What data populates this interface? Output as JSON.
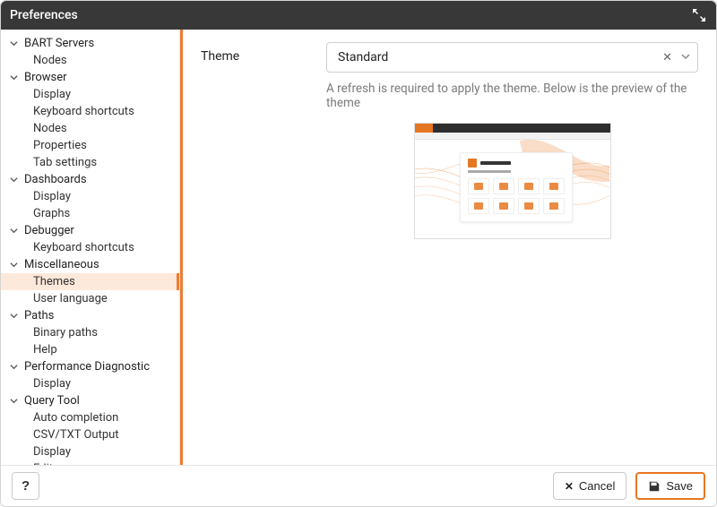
{
  "window": {
    "title": "Preferences"
  },
  "sidebar": {
    "groups": [
      {
        "label": "BART Servers",
        "items": [
          {
            "label": "Nodes"
          }
        ]
      },
      {
        "label": "Browser",
        "items": [
          {
            "label": "Display"
          },
          {
            "label": "Keyboard shortcuts"
          },
          {
            "label": "Nodes"
          },
          {
            "label": "Properties"
          },
          {
            "label": "Tab settings"
          }
        ]
      },
      {
        "label": "Dashboards",
        "items": [
          {
            "label": "Display"
          },
          {
            "label": "Graphs"
          }
        ]
      },
      {
        "label": "Debugger",
        "items": [
          {
            "label": "Keyboard shortcuts"
          }
        ]
      },
      {
        "label": "Miscellaneous",
        "items": [
          {
            "label": "Themes",
            "selected": true
          },
          {
            "label": "User language"
          }
        ]
      },
      {
        "label": "Paths",
        "items": [
          {
            "label": "Binary paths"
          },
          {
            "label": "Help"
          }
        ]
      },
      {
        "label": "Performance Diagnostic",
        "items": [
          {
            "label": "Display"
          }
        ]
      },
      {
        "label": "Query Tool",
        "items": [
          {
            "label": "Auto completion"
          },
          {
            "label": "CSV/TXT Output"
          },
          {
            "label": "Display"
          },
          {
            "label": "Editor"
          }
        ]
      }
    ]
  },
  "content": {
    "field_label": "Theme",
    "select_value": "Standard",
    "helper_text": "A refresh is required to apply the theme. Below is the preview of the theme"
  },
  "footer": {
    "help_label": "?",
    "cancel_label": "Cancel",
    "save_label": "Save"
  }
}
